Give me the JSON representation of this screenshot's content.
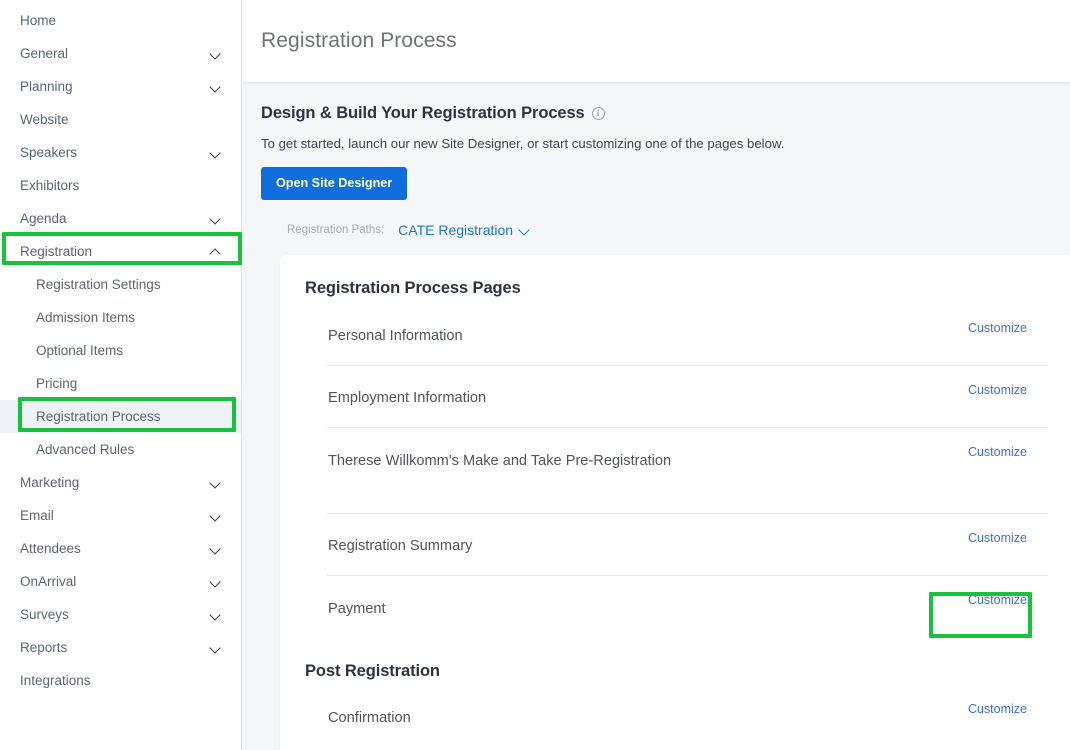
{
  "sidebar": {
    "items": [
      {
        "label": "Home",
        "chevron": "none",
        "level": "top",
        "state": "normal"
      },
      {
        "label": "General",
        "chevron": "down",
        "level": "top",
        "state": "normal"
      },
      {
        "label": "Planning",
        "chevron": "down",
        "level": "top",
        "state": "normal"
      },
      {
        "label": "Website",
        "chevron": "none",
        "level": "top",
        "state": "normal"
      },
      {
        "label": "Speakers",
        "chevron": "down",
        "level": "top",
        "state": "normal"
      },
      {
        "label": "Exhibitors",
        "chevron": "none",
        "level": "top",
        "state": "normal"
      },
      {
        "label": "Agenda",
        "chevron": "down",
        "level": "top",
        "state": "normal"
      },
      {
        "label": "Registration",
        "chevron": "up",
        "level": "top",
        "state": "expanded"
      },
      {
        "label": "Registration Settings",
        "chevron": "none",
        "level": "sub",
        "state": "normal"
      },
      {
        "label": "Admission Items",
        "chevron": "none",
        "level": "sub",
        "state": "normal"
      },
      {
        "label": "Optional Items",
        "chevron": "none",
        "level": "sub",
        "state": "normal"
      },
      {
        "label": "Pricing",
        "chevron": "none",
        "level": "sub",
        "state": "normal"
      },
      {
        "label": "Registration Process",
        "chevron": "none",
        "level": "sub",
        "state": "active"
      },
      {
        "label": "Advanced Rules",
        "chevron": "none",
        "level": "sub",
        "state": "normal"
      },
      {
        "label": "Marketing",
        "chevron": "down",
        "level": "top",
        "state": "normal"
      },
      {
        "label": "Email",
        "chevron": "down",
        "level": "top",
        "state": "normal"
      },
      {
        "label": "Attendees",
        "chevron": "down",
        "level": "top",
        "state": "normal"
      },
      {
        "label": "OnArrival",
        "chevron": "down",
        "level": "top",
        "state": "normal"
      },
      {
        "label": "Surveys",
        "chevron": "down",
        "level": "top",
        "state": "normal"
      },
      {
        "label": "Reports",
        "chevron": "down",
        "level": "top",
        "state": "normal"
      },
      {
        "label": "Integrations",
        "chevron": "none",
        "level": "top",
        "state": "normal"
      }
    ]
  },
  "header": {
    "title": "Registration Process"
  },
  "designSection": {
    "heading": "Design & Build Your Registration Process",
    "info_icon": "info-circle-icon",
    "description": "To get started, launch our new Site Designer, or start customizing one of the pages below.",
    "primary_button": "Open Site Designer",
    "paths_label": "Registration Paths:",
    "paths_value": "CATE Registration",
    "paths_chevron": "chevron-down-icon"
  },
  "card": {
    "title": "Registration Process Pages",
    "customize_label": "Customize",
    "pages": [
      {
        "name": "Personal Information"
      },
      {
        "name": "Employment Information"
      },
      {
        "name": "Therese Willkomm's Make and Take Pre-Registration"
      },
      {
        "name": "Registration Summary"
      },
      {
        "name": "Payment"
      }
    ],
    "post_registration": {
      "title": "Post Registration",
      "pages": [
        {
          "name": "Confirmation"
        }
      ]
    }
  },
  "annotations": {
    "highlight_color": "#19c23c",
    "boxes": [
      {
        "name": "registration-nav-highlight"
      },
      {
        "name": "registration-process-nav-highlight"
      },
      {
        "name": "payment-customize-highlight"
      }
    ]
  },
  "colors": {
    "accent_blue": "#0f6ddc",
    "link_blue": "#3b6de5",
    "highlight_green": "#19c23c",
    "sidebar_text": "#5b6573",
    "active_bg": "#eff3f8"
  }
}
